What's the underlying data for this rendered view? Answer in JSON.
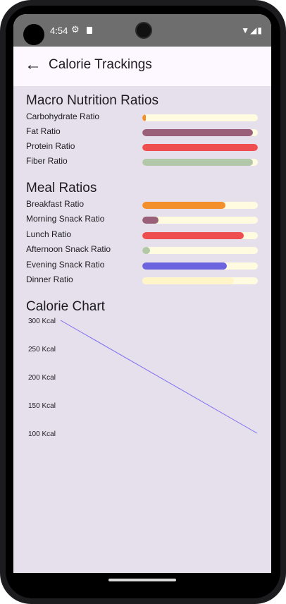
{
  "status": {
    "time": "4:54"
  },
  "appbar": {
    "title": "Calorie Trackings"
  },
  "macro": {
    "title": "Macro Nutrition Ratios",
    "items": [
      {
        "label": "Carbohydrate Ratio",
        "ratio": 0.03,
        "color": "#f4902b"
      },
      {
        "label": "Fat Ratio",
        "ratio": 0.96,
        "color": "#9b6079"
      },
      {
        "label": "Protein Ratio",
        "ratio": 1.0,
        "color": "#ef4e50"
      },
      {
        "label": "Fiber Ratio",
        "ratio": 0.96,
        "color": "#b2c8a8"
      }
    ]
  },
  "meals": {
    "title": "Meal Ratios",
    "items": [
      {
        "label": "Breakfast Ratio",
        "ratio": 0.72,
        "color": "#f4902b"
      },
      {
        "label": "Morning Snack Ratio",
        "ratio": 0.14,
        "color": "#9b6079"
      },
      {
        "label": "Lunch Ratio",
        "ratio": 0.88,
        "color": "#ef4e50"
      },
      {
        "label": "Afternoon Snack Ratio",
        "ratio": 0.07,
        "color": "#b2c8a8"
      },
      {
        "label": "Evening Snack Ratio",
        "ratio": 0.73,
        "color": "#6c63df"
      },
      {
        "label": "Dinner Ratio",
        "ratio": 0.79,
        "color": "#fff5c8"
      }
    ]
  },
  "chart": {
    "title": "Calorie Chart"
  },
  "chart_data": {
    "type": "line",
    "title": "",
    "xlabel": "",
    "ylabel": "",
    "ylim": [
      100,
      300
    ],
    "yticks": [
      "300 Kcal",
      "250 Kcal",
      "200 Kcal",
      "150 Kcal",
      "100 Kcal"
    ],
    "grid": false,
    "series": [
      {
        "values": [
          300,
          100
        ],
        "color": "#7b6cf0"
      }
    ]
  }
}
